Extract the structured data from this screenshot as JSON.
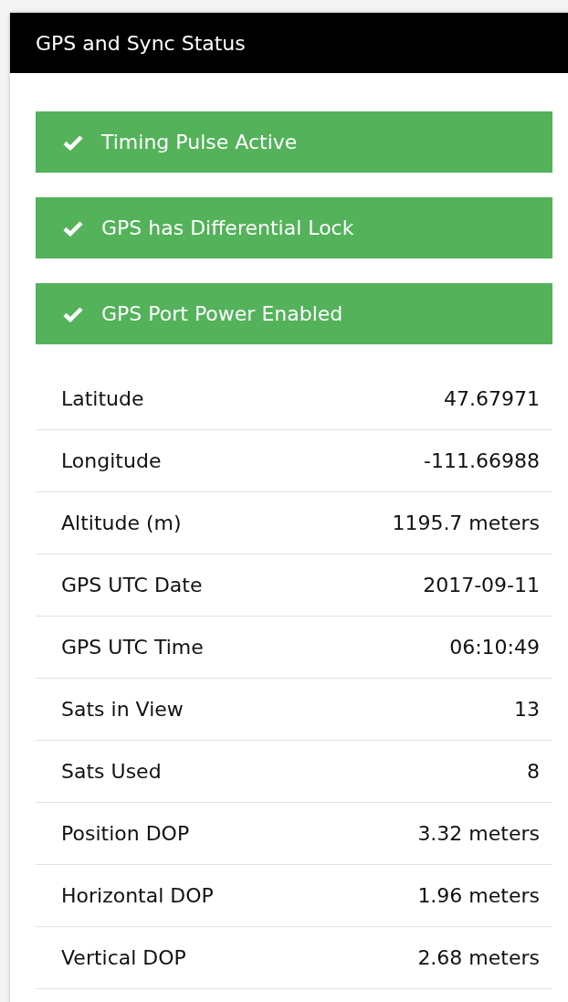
{
  "panel": {
    "title": "GPS and Sync Status"
  },
  "alerts": [
    {
      "kind": "success",
      "text": "Timing Pulse Active"
    },
    {
      "kind": "success",
      "text": "GPS has Differential Lock"
    },
    {
      "kind": "success",
      "text": "GPS Port Power Enabled"
    }
  ],
  "rows": [
    {
      "label": "Latitude",
      "value": "47.67971"
    },
    {
      "label": "Longitude",
      "value": "-111.66988"
    },
    {
      "label": "Altitude (m)",
      "value": "1195.7 meters"
    },
    {
      "label": "GPS UTC Date",
      "value": "2017-09-11"
    },
    {
      "label": "GPS UTC Time",
      "value": "06:10:49"
    },
    {
      "label": "Sats in View",
      "value": "13"
    },
    {
      "label": "Sats Used",
      "value": "8"
    },
    {
      "label": "Position DOP",
      "value": "3.32 meters"
    },
    {
      "label": "Horizontal DOP",
      "value": "1.96 meters"
    },
    {
      "label": "Vertical DOP",
      "value": "2.68 meters"
    }
  ]
}
